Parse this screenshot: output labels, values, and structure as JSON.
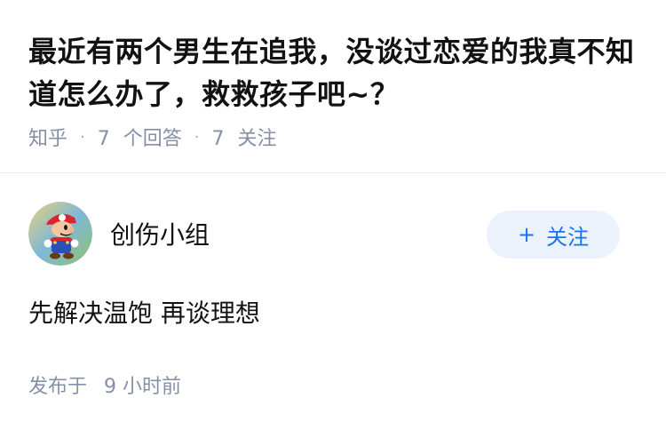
{
  "question": {
    "title": "最近有两个男生在追我，没谈过恋爱的我真不知道怎么办了，救救孩子吧~？",
    "source": "知乎",
    "separator": "·",
    "answer_count": "7",
    "answer_unit": "个回答",
    "follow_count": "7",
    "follow_unit": "关注"
  },
  "answer": {
    "author_name": "创伤小组",
    "follow_button_plus": "+",
    "follow_button_label": "关注",
    "content": "先解决温饱 再谈理想",
    "time_prefix": "发布于",
    "time_value": "9 小时前"
  },
  "colors": {
    "text_primary": "#121212",
    "text_secondary": "#8590a6",
    "accent": "#1772f6",
    "button_bg": "#ebf2fb"
  },
  "icons": {
    "avatar": "mario-avatar-icon"
  }
}
